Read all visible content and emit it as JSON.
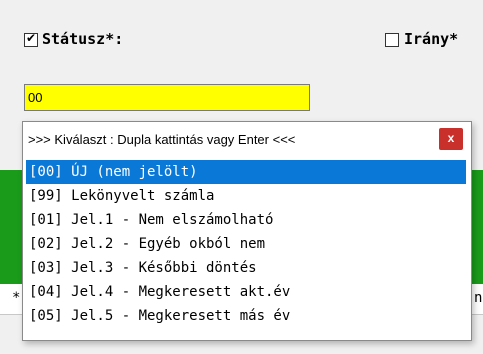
{
  "status": {
    "checkbox_checked": true,
    "label": "Státusz*:",
    "input_value": "00"
  },
  "direction": {
    "checkbox_checked": false,
    "label": "Irány*"
  },
  "background_strip": {
    "left_char": "*",
    "right_char": "n"
  },
  "popup": {
    "title": ">>> Kiválaszt : Dupla kattintás vagy Enter <<<",
    "close_label": "x",
    "selected_index": 0,
    "items": [
      "[00] ÚJ (nem jelölt)",
      "[99] Lekönyvelt számla",
      "[01] Jel.1 - Nem elszámolható",
      "[02] Jel.2 - Egyéb okból nem",
      "[03] Jel.3 - Későbbi döntés",
      "[04] Jel.4 - Megkeresett akt.év",
      "[05] Jel.5 - Megkeresett más év"
    ]
  },
  "colors": {
    "input_bg": "#ffff00",
    "selection": "#0a78d7",
    "close_button": "#c9302c",
    "green_band": "#1a9b1a"
  }
}
